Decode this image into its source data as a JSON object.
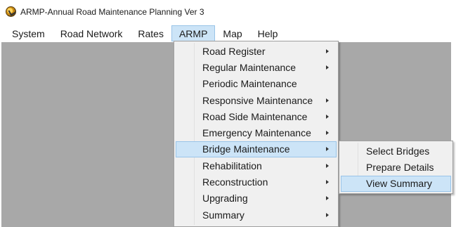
{
  "window": {
    "title": "ARMP-Annual Road Maintenance Planning Ver 3",
    "icon": "app-icon"
  },
  "menubar": {
    "items": [
      {
        "label": "System"
      },
      {
        "label": "Road Network"
      },
      {
        "label": "Rates"
      },
      {
        "label": "ARMP"
      },
      {
        "label": "Map"
      },
      {
        "label": "Help"
      }
    ],
    "active_index": 3
  },
  "armp_menu": {
    "items": [
      {
        "label": "Road Register",
        "has_submenu": true
      },
      {
        "label": "Regular Maintenance",
        "has_submenu": true
      },
      {
        "label": "Periodic Maintenance",
        "has_submenu": false
      },
      {
        "label": "Responsive Maintenance",
        "has_submenu": true
      },
      {
        "label": "Road Side Maintenance",
        "has_submenu": true
      },
      {
        "label": "Emergency Maintenance",
        "has_submenu": true
      },
      {
        "label": "Bridge Maintenance",
        "has_submenu": true
      },
      {
        "label": "Rehabilitation",
        "has_submenu": true
      },
      {
        "label": "Reconstruction",
        "has_submenu": true
      },
      {
        "label": "Upgrading",
        "has_submenu": true
      },
      {
        "label": "Summary",
        "has_submenu": true
      }
    ],
    "highlighted_index": 6
  },
  "bridge_submenu": {
    "items": [
      {
        "label": "Select Bridges"
      },
      {
        "label": "Prepare Details"
      },
      {
        "label": "View Summary"
      }
    ],
    "highlighted_index": 2
  },
  "colors": {
    "highlight_bg": "#cce4f7",
    "highlight_border": "#99c4e8",
    "client_area": "#a8a8a8",
    "menu_bg": "#f0f0f0"
  }
}
